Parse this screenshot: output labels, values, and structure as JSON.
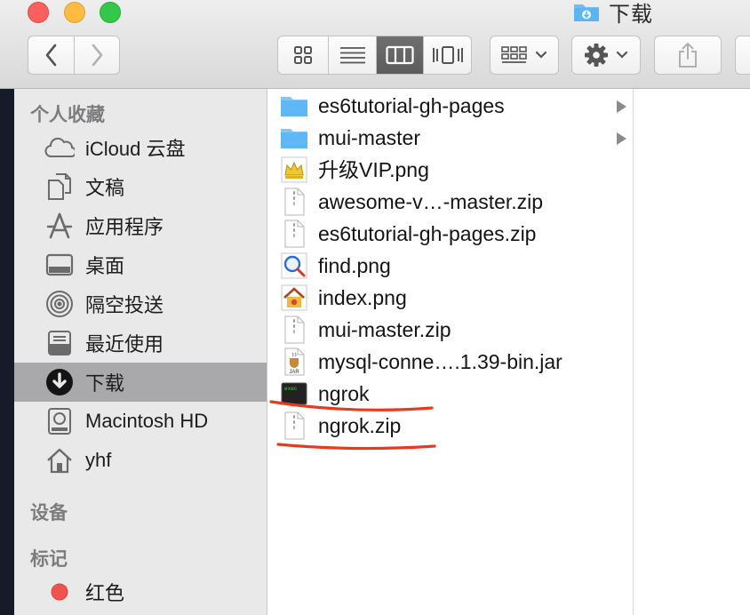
{
  "window": {
    "title": "下载",
    "title_icon": "downloads-folder-icon"
  },
  "toolbar": {
    "back": "chevron-left-icon",
    "forward": "chevron-right-icon",
    "view_modes": [
      "icon-view-icon",
      "list-view-icon",
      "column-view-icon",
      "cover-flow-icon"
    ],
    "active_view": "column-view-icon",
    "arrange": "arrange-grid-icon",
    "action": "gear-icon",
    "share": "share-icon"
  },
  "sidebar": {
    "favorites_title": "个人收藏",
    "favorites": [
      {
        "label": "iCloud 云盘",
        "icon": "cloud-icon"
      },
      {
        "label": "文稿",
        "icon": "documents-icon"
      },
      {
        "label": "应用程序",
        "icon": "applications-icon"
      },
      {
        "label": "桌面",
        "icon": "desktop-icon"
      },
      {
        "label": "隔空投送",
        "icon": "airdrop-icon"
      },
      {
        "label": "最近使用",
        "icon": "recents-icon"
      },
      {
        "label": "下载",
        "icon": "downloads-icon",
        "selected": true
      },
      {
        "label": "Macintosh HD",
        "icon": "hard-drive-icon"
      },
      {
        "label": "yhf",
        "icon": "home-icon"
      }
    ],
    "devices_title": "设备",
    "tags_title": "标记",
    "tags": [
      {
        "label": "红色",
        "color": "#f1524d"
      }
    ]
  },
  "files": [
    {
      "name": "es6tutorial-gh-pages",
      "icon": "folder-icon",
      "folder": true
    },
    {
      "name": "mui-master",
      "icon": "folder-icon",
      "folder": true
    },
    {
      "name": "升级VIP.png",
      "icon": "image-crown-icon"
    },
    {
      "name": "awesome-v…-master.zip",
      "icon": "zip-file-icon"
    },
    {
      "name": "es6tutorial-gh-pages.zip",
      "icon": "zip-file-icon"
    },
    {
      "name": "find.png",
      "icon": "image-search-icon"
    },
    {
      "name": "index.png",
      "icon": "image-home-icon"
    },
    {
      "name": "mui-master.zip",
      "icon": "zip-file-icon"
    },
    {
      "name": "mysql-conne….1.39-bin.jar",
      "icon": "jar-file-icon",
      "jar_label": "JAR"
    },
    {
      "name": "ngrok",
      "icon": "terminal-exec-icon",
      "exec_label": "exec"
    },
    {
      "name": "ngrok.zip",
      "icon": "zip-file-icon"
    }
  ],
  "colors": {
    "annotation": "#e83a1e",
    "selection": "#a9a9ab",
    "folder": "#5fb7f5"
  }
}
